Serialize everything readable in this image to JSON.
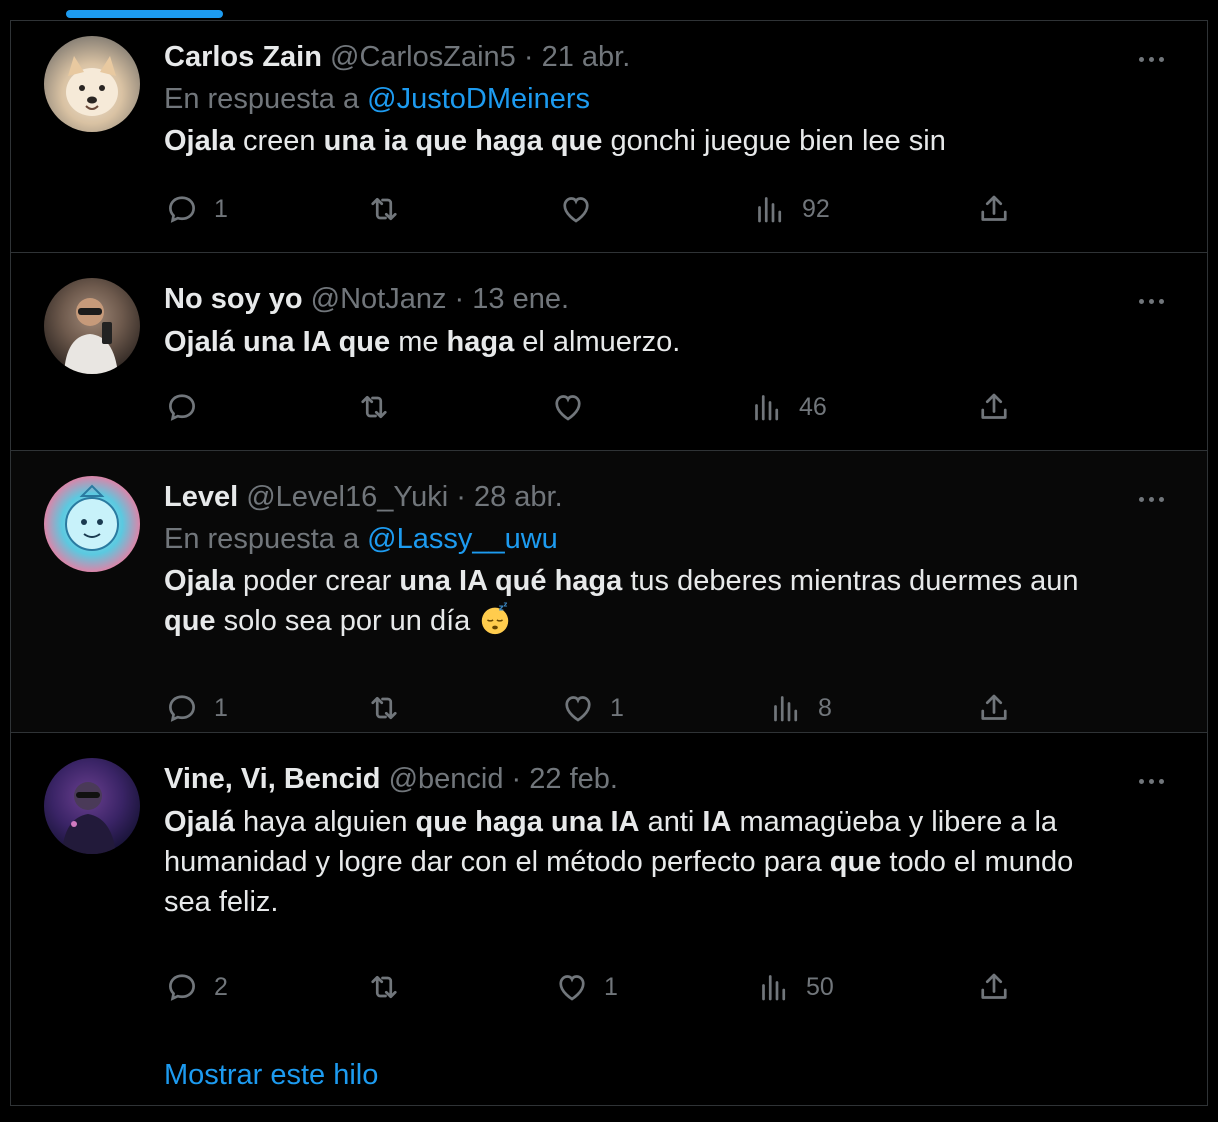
{
  "tweets": [
    {
      "name": "Carlos Zain",
      "handle": "@CarlosZain5",
      "sep": " · ",
      "date": "21 abr.",
      "reply_prefix": "En respuesta a ",
      "reply_to": "@JustoDMeiners",
      "body": [
        {
          "t": "Ojala",
          "b": true
        },
        {
          "t": " creen ",
          "b": false
        },
        {
          "t": "una ia que haga que",
          "b": true
        },
        {
          "t": " gonchi juegue bien lee sin",
          "b": false
        }
      ],
      "replies": "1",
      "retweets": "",
      "likes": "",
      "views": "92",
      "avatar_icon": "dog-avatar"
    },
    {
      "name": "No soy yo",
      "handle": "@NotJanz",
      "sep": " · ",
      "date": "13 ene.",
      "reply_prefix": "",
      "reply_to": "",
      "body": [
        {
          "t": "Ojalá una IA que",
          "b": true
        },
        {
          "t": " me ",
          "b": false
        },
        {
          "t": "haga",
          "b": true
        },
        {
          "t": " el almuerzo.",
          "b": false
        }
      ],
      "replies": "",
      "retweets": "",
      "likes": "",
      "views": "46",
      "avatar_icon": "person-avatar"
    },
    {
      "name": "Level",
      "handle": "@Level16_Yuki",
      "sep": " · ",
      "date": "28 abr.",
      "reply_prefix": "En respuesta a ",
      "reply_to": "@Lassy__uwu",
      "body_line1": [
        {
          "t": "Ojala",
          "b": true
        },
        {
          "t": " poder crear ",
          "b": false
        },
        {
          "t": "una IA qué haga",
          "b": true
        },
        {
          "t": " tus deberes mientras duermes aun",
          "b": false
        }
      ],
      "body_line2": [
        {
          "t": "que",
          "b": true
        },
        {
          "t": " solo sea por un día ",
          "b": false
        }
      ],
      "replies": "1",
      "retweets": "",
      "likes": "1",
      "views": "8",
      "avatar_icon": "cartoon-avatar"
    },
    {
      "name": "Vine, Vi, Bencid",
      "handle": "@bencid",
      "sep": " · ",
      "date": "22 feb.",
      "reply_prefix": "",
      "reply_to": "",
      "body_line1": [
        {
          "t": "Ojalá",
          "b": true
        },
        {
          "t": " haya alguien ",
          "b": false
        },
        {
          "t": "que haga una IA",
          "b": true
        },
        {
          "t": " anti ",
          "b": false
        },
        {
          "t": "IA",
          "b": true
        },
        {
          "t": " mamagüeba y libere a la",
          "b": false
        }
      ],
      "body_line2": [
        {
          "t": "humanidad y logre dar con el método perfecto para ",
          "b": false
        },
        {
          "t": "que",
          "b": true
        },
        {
          "t": " todo el mundo",
          "b": false
        }
      ],
      "body_line3": [
        {
          "t": "sea feliz.",
          "b": false
        }
      ],
      "replies": "2",
      "retweets": "",
      "likes": "1",
      "views": "50",
      "avatar_icon": "dark-person-avatar"
    }
  ],
  "show_thread": "Mostrar este hilo",
  "colors": {
    "accent": "#1d9bf0",
    "muted": "#71767b",
    "text": "#e7e9ea",
    "border": "#2f3336"
  }
}
